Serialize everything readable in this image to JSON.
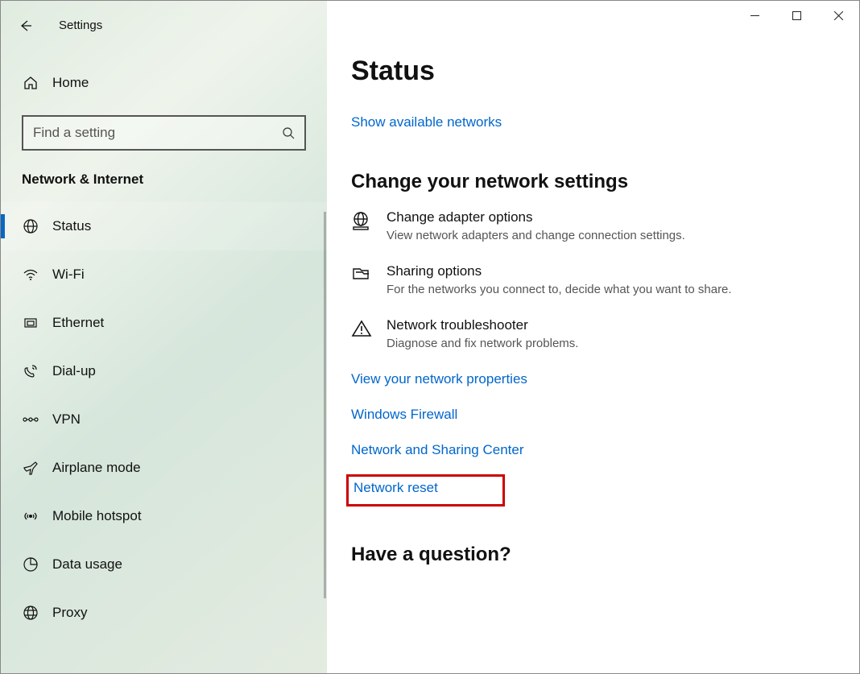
{
  "window_title": "Settings",
  "sidebar": {
    "home_label": "Home",
    "search_placeholder": "Find a setting",
    "category": "Network & Internet",
    "items": [
      {
        "label": "Status",
        "icon": "globe-icon"
      },
      {
        "label": "Wi-Fi",
        "icon": "wifi-icon"
      },
      {
        "label": "Ethernet",
        "icon": "ethernet-icon"
      },
      {
        "label": "Dial-up",
        "icon": "dialup-icon"
      },
      {
        "label": "VPN",
        "icon": "vpn-icon"
      },
      {
        "label": "Airplane mode",
        "icon": "airplane-icon"
      },
      {
        "label": "Mobile hotspot",
        "icon": "hotspot-icon"
      },
      {
        "label": "Data usage",
        "icon": "datausage-icon"
      },
      {
        "label": "Proxy",
        "icon": "proxy-icon"
      }
    ],
    "active_index": 0
  },
  "main": {
    "title": "Status",
    "show_networks_link": "Show available networks",
    "change_section": "Change your network settings",
    "options": [
      {
        "title": "Change adapter options",
        "desc": "View network adapters and change connection settings.",
        "icon": "adapter-icon"
      },
      {
        "title": "Sharing options",
        "desc": "For the networks you connect to, decide what you want to share.",
        "icon": "sharing-icon"
      },
      {
        "title": "Network troubleshooter",
        "desc": "Diagnose and fix network problems.",
        "icon": "warning-icon"
      }
    ],
    "links": [
      "View your network properties",
      "Windows Firewall",
      "Network and Sharing Center"
    ],
    "highlighted_link": "Network reset",
    "question_section": "Have a question?"
  }
}
